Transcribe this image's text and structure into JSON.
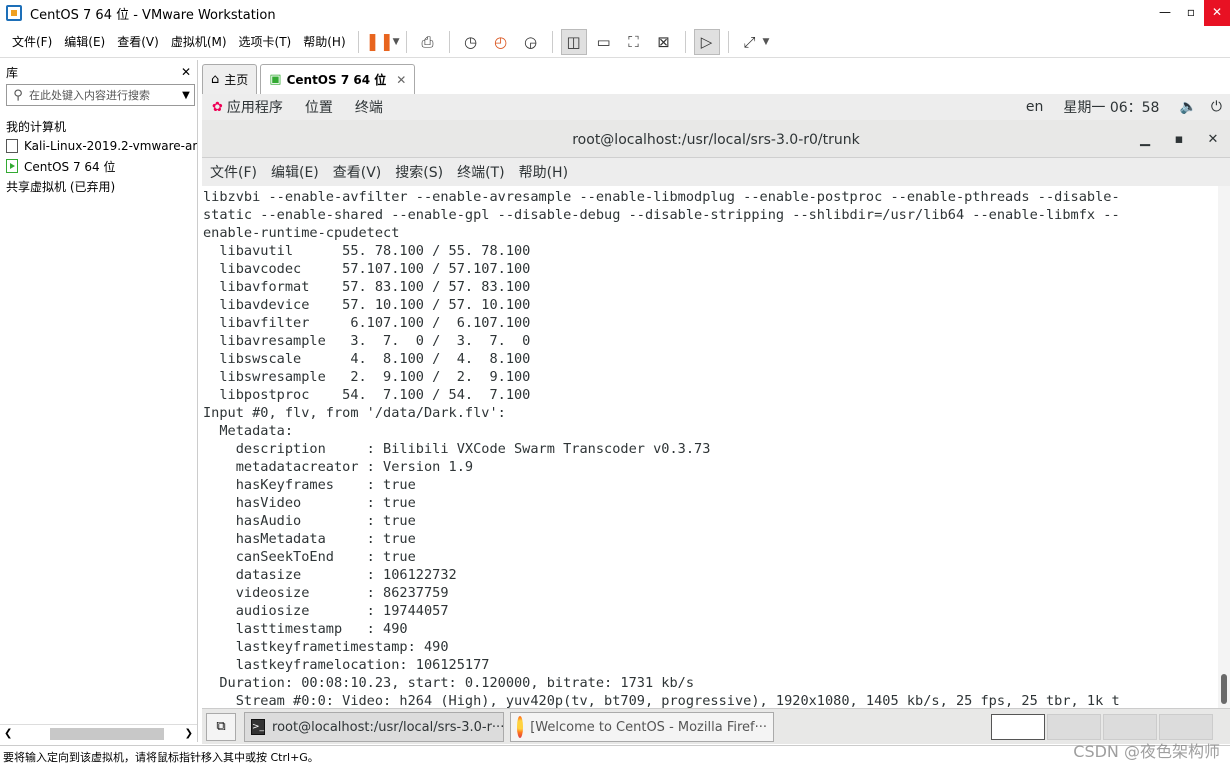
{
  "window": {
    "title": "CentOS 7 64 位 - VMware Workstation",
    "min": "—",
    "max": "▫",
    "close": "✕"
  },
  "menubar": {
    "items": [
      "文件(F)",
      "编辑(E)",
      "查看(V)",
      "虚拟机(M)",
      "选项卡(T)",
      "帮助(H)"
    ],
    "toolbar_icons": [
      "pause-icon",
      "send-ctrl-alt-del-icon",
      "snapshot-icon",
      "revert-snapshot-icon",
      "snapshot-manager-icon",
      "library-view-icon",
      "thumbnail-bar-icon",
      "full-screen-icon",
      "unity-icon",
      "console-view-icon",
      "stretch-guest-icon"
    ]
  },
  "library": {
    "title": "库",
    "close": "✕",
    "search_placeholder": "在此处键入内容进行搜索",
    "tree": {
      "my_computer": "我的计算机",
      "vm1": "Kali-Linux-2019.2-vmware-am",
      "vm2": "CentOS 7 64 位",
      "shared": "共享虚拟机 (已弃用)"
    }
  },
  "tabs": [
    {
      "label": "主页",
      "icon": "home-icon"
    },
    {
      "label": "CentOS 7 64 位",
      "icon": "vm-running-icon",
      "close": "✕"
    }
  ],
  "gnome_top_bar": {
    "applications": "应用程序",
    "places": "位置",
    "terminal": "终端",
    "input_method": "en",
    "clock": "星期一 06：58",
    "volume_icon": "volume-icon",
    "power_icon": "power-icon"
  },
  "terminal": {
    "title": "root@localhost:/usr/local/srs-3.0-r0/trunk",
    "controls": {
      "minimize": "▁",
      "maximize": "▪",
      "close": "✕"
    },
    "menu": [
      "文件(F)",
      "编辑(E)",
      "查看(V)",
      "搜索(S)",
      "终端(T)",
      "帮助(H)"
    ],
    "lines": [
      "libzvbi --enable-avfilter --enable-avresample --enable-libmodplug --enable-postproc --enable-pthreads --disable-",
      "static --enable-shared --enable-gpl --disable-debug --disable-stripping --shlibdir=/usr/lib64 --enable-libmfx --",
      "enable-runtime-cpudetect",
      "  libavutil      55. 78.100 / 55. 78.100",
      "  libavcodec     57.107.100 / 57.107.100",
      "  libavformat    57. 83.100 / 57. 83.100",
      "  libavdevice    57. 10.100 / 57. 10.100",
      "  libavfilter     6.107.100 /  6.107.100",
      "  libavresample   3.  7.  0 /  3.  7.  0",
      "  libswscale      4.  8.100 /  4.  8.100",
      "  libswresample   2.  9.100 /  2.  9.100",
      "  libpostproc    54.  7.100 / 54.  7.100",
      "Input #0, flv, from '/data/Dark.flv':",
      "  Metadata:",
      "    description     : Bilibili VXCode Swarm Transcoder v0.3.73",
      "    metadatacreator : Version 1.9",
      "    hasKeyframes    : true",
      "    hasVideo        : true",
      "    hasAudio        : true",
      "    hasMetadata     : true",
      "    canSeekToEnd    : true",
      "    datasize        : 106122732",
      "    videosize       : 86237759",
      "    audiosize       : 19744057",
      "    lasttimestamp   : 490",
      "    lastkeyframetimestamp: 490",
      "    lastkeyframelocation: 106125177",
      "  Duration: 00:08:10.23, start: 0.120000, bitrate: 1731 kb/s",
      "    Stream #0:0: Video: h264 (High), yuv420p(tv, bt709, progressive), 1920x1080, 1405 kb/s, 25 fps, 25 tbr, 1k t"
    ]
  },
  "guest_taskbar": {
    "show_desktop": "⧉",
    "terminal_task": "root@localhost:/usr/local/srs-3.0-r···",
    "firefox_task": "[Welcome to CentOS - Mozilla Firef···"
  },
  "statusbar": {
    "text": "要将输入定向到该虚拟机，请将鼠标指针移入其中或按 Ctrl+G。"
  },
  "watermark": "CSDN @夜色架构师"
}
